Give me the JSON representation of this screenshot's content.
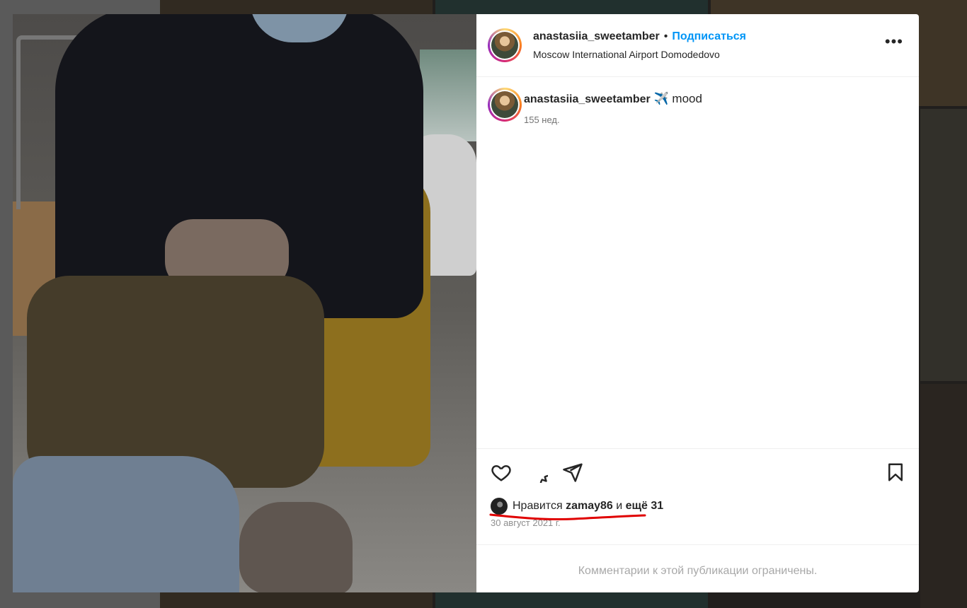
{
  "post": {
    "username": "anastasiia_sweetamber",
    "separator": "•",
    "follow_label": "Подписаться",
    "location": "Moscow International Airport Domodedovo",
    "more_label": "•••",
    "caption_emoji": "✈️",
    "caption_text": "mood",
    "caption_age": "155 нед.",
    "likes_prefix": "Нравится",
    "likes_user": "zamay86",
    "likes_and": "и",
    "likes_more": "ещё 31",
    "date": "30 август 2021 г.",
    "comments_disabled": "Комментарии к этой публикации ограничены."
  },
  "icons": {
    "like": "heart-icon",
    "comment": "comment-icon",
    "share": "share-icon",
    "save": "bookmark-icon"
  },
  "colors": {
    "accent": "#0095f6",
    "annotation": "#e00000"
  }
}
